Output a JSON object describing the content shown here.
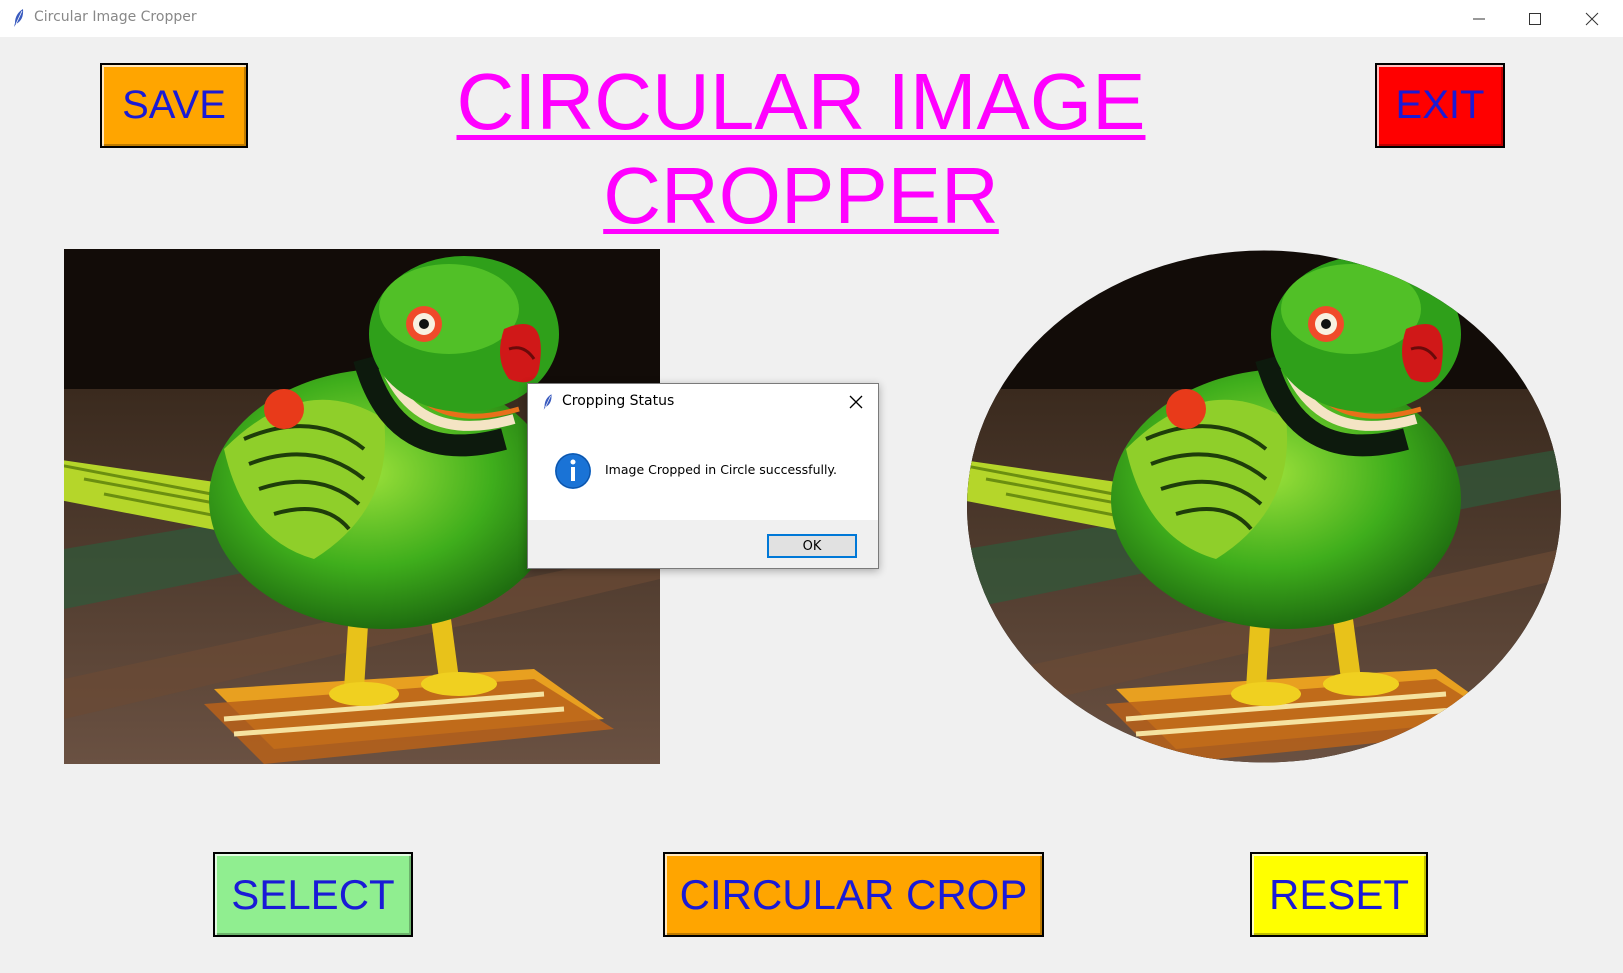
{
  "window": {
    "title": "Circular Image Cropper",
    "controls": [
      "minimize-icon",
      "maximize-icon",
      "close-icon"
    ]
  },
  "app": {
    "title": "CIRCULAR IMAGE CROPPER",
    "title_color": "#ff00ff",
    "button_text_color": "#1a1ad6"
  },
  "buttons": {
    "save": {
      "label": "SAVE",
      "color": "#ffa500"
    },
    "exit": {
      "label": "EXIT",
      "color": "#ff0000"
    },
    "select": {
      "label": "SELECT",
      "color": "#90ee90"
    },
    "crop": {
      "label": "CIRCULAR CROP",
      "color": "#ffa500"
    },
    "reset": {
      "label": "RESET",
      "color": "#ffff00"
    }
  },
  "images": {
    "original": {
      "subject": "green wooden parrot figurine",
      "shape": "rectangle"
    },
    "cropped": {
      "subject": "green wooden parrot figurine",
      "shape": "ellipse"
    }
  },
  "dialog": {
    "title": "Cropping Status",
    "icon": "info-icon",
    "message": "Image Cropped in Circle successfully.",
    "ok_label": "OK"
  }
}
